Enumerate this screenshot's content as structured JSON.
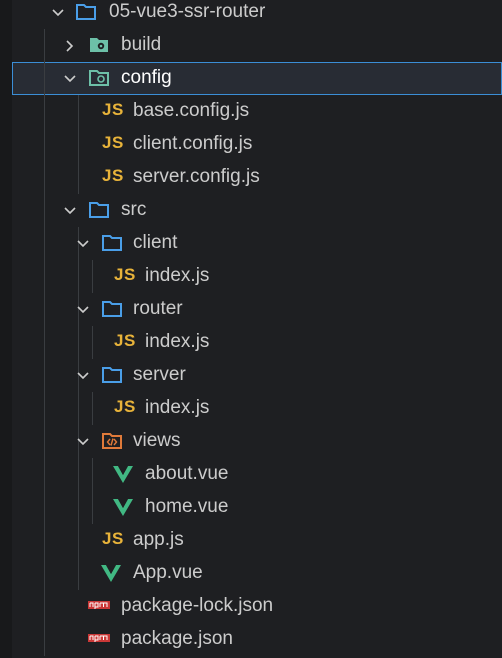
{
  "tree": {
    "root": {
      "label": "05-vue3-ssr-router",
      "icon": "folder-open-icon",
      "expanded": true
    },
    "build": {
      "label": "build",
      "icon": "config-folder-icon",
      "expanded": false
    },
    "config": {
      "label": "config",
      "icon": "config-folder-icon",
      "expanded": true,
      "selected": true
    },
    "base_config": {
      "label": "base.config.js",
      "icon": "js-file-icon",
      "glyph": "JS"
    },
    "client_config": {
      "label": "client.config.js",
      "icon": "js-file-icon",
      "glyph": "JS"
    },
    "server_config": {
      "label": "server.config.js",
      "icon": "js-file-icon",
      "glyph": "JS"
    },
    "src": {
      "label": "src",
      "icon": "folder-open-icon",
      "expanded": true
    },
    "client": {
      "label": "client",
      "icon": "folder-open-icon",
      "expanded": true
    },
    "client_index": {
      "label": "index.js",
      "icon": "js-file-icon",
      "glyph": "JS"
    },
    "router": {
      "label": "router",
      "icon": "folder-open-icon",
      "expanded": true
    },
    "router_index": {
      "label": "index.js",
      "icon": "js-file-icon",
      "glyph": "JS"
    },
    "server": {
      "label": "server",
      "icon": "folder-open-icon",
      "expanded": true
    },
    "server_index": {
      "label": "index.js",
      "icon": "js-file-icon",
      "glyph": "JS"
    },
    "views": {
      "label": "views",
      "icon": "views-folder-icon",
      "expanded": true
    },
    "about_vue": {
      "label": "about.vue",
      "icon": "vue-file-icon"
    },
    "home_vue": {
      "label": "home.vue",
      "icon": "vue-file-icon"
    },
    "app_js": {
      "label": "app.js",
      "icon": "js-file-icon",
      "glyph": "JS"
    },
    "app_vue": {
      "label": "App.vue",
      "icon": "vue-file-icon"
    },
    "package_lock": {
      "label": "package-lock.json",
      "icon": "npm-file-icon"
    },
    "package_json": {
      "label": "package.json",
      "icon": "npm-file-icon"
    }
  },
  "colors": {
    "background": "#1e1f22",
    "selection_border": "#3b8ed6",
    "folder_blue": "#4a9ee8",
    "config_folder_green": "#6dc0a8",
    "js_yellow": "#e8b33a",
    "vue_green": "#41b883",
    "npm_red": "#cb3837",
    "views_orange": "#e07a3a"
  }
}
